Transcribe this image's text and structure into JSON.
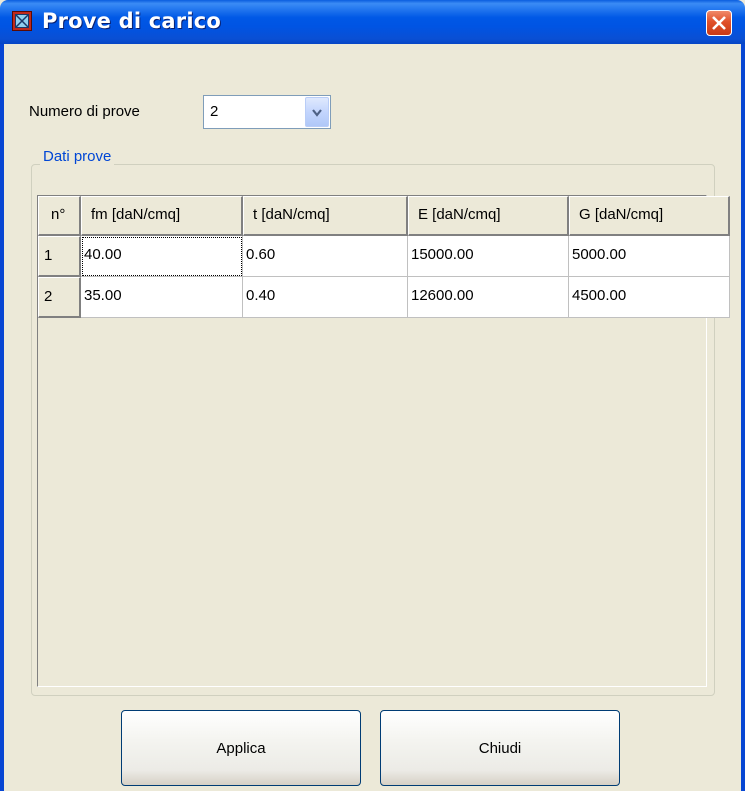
{
  "window": {
    "title": "Prove di carico"
  },
  "test_count": {
    "label": "Numero di prove",
    "value": "2"
  },
  "group": {
    "legend": "Dati prove"
  },
  "grid": {
    "headers": [
      "n°",
      "fm  [daN/cmq]",
      "t  [daN/cmq]",
      "E  [daN/cmq]",
      "G  [daN/cmq]"
    ],
    "rows": [
      {
        "n": "1",
        "fm": "40.00",
        "t": "0.60",
        "E": "15000.00",
        "G": "5000.00"
      },
      {
        "n": "2",
        "fm": "35.00",
        "t": "0.40",
        "E": "12600.00",
        "G": "4500.00"
      }
    ]
  },
  "buttons": {
    "apply": "Applica",
    "close": "Chiudi"
  },
  "colors": {
    "titlebar": "#0054e3",
    "legend": "#0046d5",
    "close": "#e0512a",
    "face": "#ece9d8"
  }
}
